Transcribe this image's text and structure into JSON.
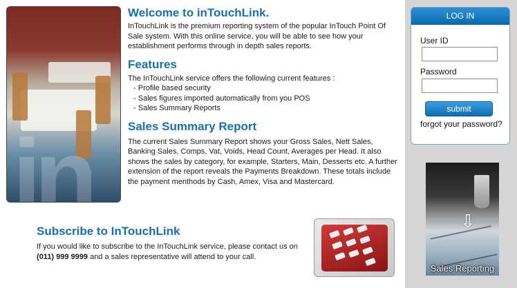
{
  "main": {
    "welcome_title": "Welcome to inTouchLink.",
    "welcome_text": "InTouchLink is the premium reporting system of the popular InTouch Point Of Sale system. With this online service, you will be able to see how your establishment performs through in depth sales reports.",
    "features_title": "Features",
    "features_intro": "The InTouchLink service offers the following current features :",
    "features": [
      "Profile based security",
      "Sales figures imported automatically from you POS",
      "Sales Summary Reports"
    ],
    "summary_title": "Sales Summary Report",
    "summary_text": "The current Sales Summary Report shows your Gross Sales, Nett Sales, Banking Sales, Comps, Vat, Voids, Head Count, Averages per Head. It also shows the sales by category, for example, Starters, Main, Desserts etc. A further extension of the report reveals the Payments Breakdown. These totals include the payment menthods by Cash, Amex, Visa and Mastercard."
  },
  "subscribe": {
    "title": "Subscribe to InTouchLink",
    "text_before": "If you would like to subscribe to the InTouchLink service, please contact us on ",
    "phone": "(011) 999 9999",
    "text_after": " and a sales representative will attend to your call."
  },
  "login": {
    "header": "LOG IN",
    "user_label": "User ID",
    "user_value": "",
    "password_label": "Password",
    "password_value": "",
    "submit_label": "submit",
    "forgot_label": "forgot your password?"
  },
  "sales_tile": {
    "caption": "Sales Reporting"
  },
  "colors": {
    "heading": "#1a6fa8",
    "sidebar_bg": "#d6d6d6",
    "button": "#0e6eb0"
  }
}
